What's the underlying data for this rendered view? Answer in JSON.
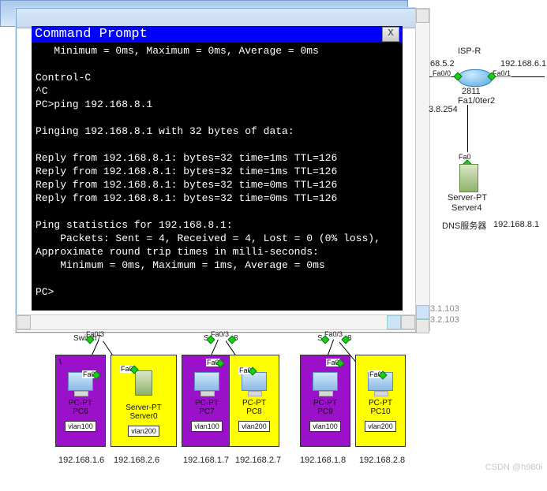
{
  "window": {
    "title": "Command Prompt",
    "close": "X"
  },
  "terminal": {
    "text": "   Minimum = 0ms, Maximum = 0ms, Average = 0ms\n\nControl-C\n^C\nPC>ping 192.168.8.1\n\nPinging 192.168.8.1 with 32 bytes of data:\n\nReply from 192.168.8.1: bytes=32 time=1ms TTL=126\nReply from 192.168.8.1: bytes=32 time=1ms TTL=126\nReply from 192.168.8.1: bytes=32 time=0ms TTL=126\nReply from 192.168.8.1: bytes=32 time=0ms TTL=126\n\nPing statistics for 192.168.8.1:\n    Packets: Sent = 4, Received = 4, Lost = 0 (0% loss),\nApproximate round trip times in milli-seconds:\n    Minimum = 0ms, Maximum = 1ms, Average = 0ms\n\nPC>"
  },
  "topo": {
    "isp": "ISP-R",
    "ip_wan_l": "68.5.2",
    "ip_wan_r": "192.168.6.1",
    "port_l": "Fa0/0",
    "port_r": "Fa0/1",
    "router_lbl1": "2811",
    "router_lbl2": "Fa1/0ter2",
    "ip_core": "3.8.254",
    "srv_port": "Fa0",
    "srv_type": "Server-PT",
    "srv_name": "Server4",
    "srv_desc": "DNS服务器",
    "srv_ip": "192.168.8.1",
    "hidden_ip1": "3.1.103",
    "hidden_ip2": "3.2.103"
  },
  "switches": {
    "s1": "Switch7",
    "s1p": "Fa0/3",
    "s2": "S",
    "s2p": "Fa0/3",
    "s2p2": "8",
    "s3": "S",
    "s3p": "Fa0/3",
    "s3p2": "8"
  },
  "devices": [
    {
      "bg": "purple",
      "corner": "\\",
      "fa": "Fa0",
      "type": "PC-PT",
      "name": "PC6",
      "vlan": "vlan100",
      "ip": "192.168.1.6",
      "icon": "pc"
    },
    {
      "bg": "yellow",
      "corner": "",
      "fa": "Fa0",
      "type": "Server-PT",
      "name": "Server0",
      "vlan": "vlan200",
      "ip": "192.168.2.6",
      "icon": "srv"
    },
    {
      "bg": "purple",
      "corner": "",
      "fa": "Fa0",
      "type": "PC-PT",
      "name": "PC7",
      "vlan": "vlan100",
      "ip": "192.168.1.7",
      "icon": "pc"
    },
    {
      "bg": "yellow",
      "corner": "",
      "fa": "Fa0",
      "type": "PC-PT",
      "name": "PC8",
      "vlan": "vlan200",
      "ip": "192.168.2.7",
      "icon": "pc"
    },
    {
      "bg": "purple",
      "corner": "",
      "fa": "Fa0",
      "type": "PC-PT",
      "name": "PC9",
      "vlan": "vlan100",
      "ip": "192.168.1.8",
      "icon": "pc"
    },
    {
      "bg": "yellow",
      "corner": "",
      "fa": "Fa0",
      "type": "PC-PT",
      "name": "PC10",
      "vlan": "vlan200",
      "ip": "192.168.2.8",
      "icon": "pc"
    }
  ],
  "watermark": "CSDN @h980i"
}
